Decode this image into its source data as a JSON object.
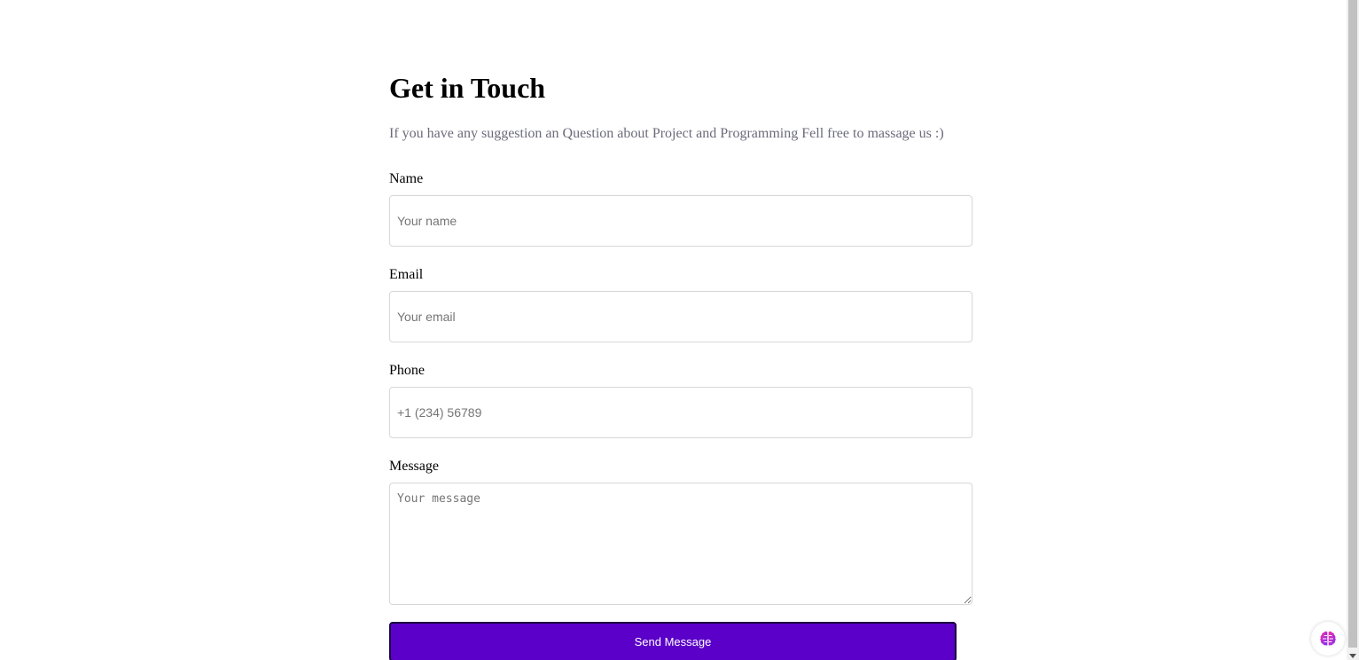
{
  "contact": {
    "title": "Get in Touch",
    "subtitle": "If you have any suggestion an Question about Project and Programming Fell free to massage us :)",
    "fields": {
      "name": {
        "label": "Name",
        "placeholder": "Your name"
      },
      "email": {
        "label": "Email",
        "placeholder": "Your email"
      },
      "phone": {
        "label": "Phone",
        "placeholder": "+1 (234) 56789"
      },
      "message": {
        "label": "Message",
        "placeholder": "Your message"
      }
    },
    "submit_label": "Send Message"
  },
  "widget": {
    "icon": "brain-icon"
  },
  "colors": {
    "button_bg": "#5b00c8",
    "button_border": "#1a0640",
    "subtitle_text": "#6b6b7b",
    "input_border": "#d7d7d7"
  }
}
